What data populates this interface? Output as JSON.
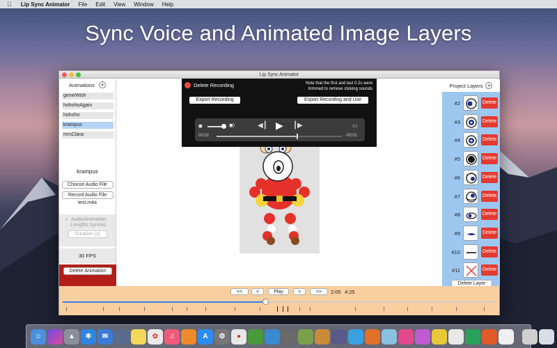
{
  "menubar": {
    "app_name": "Lip Sync Animator",
    "menus": [
      "File",
      "Edit",
      "View",
      "Window",
      "Help"
    ]
  },
  "headline": "Sync Voice and Animated Image Layers",
  "window": {
    "title": "Lip Sync Animator"
  },
  "animations_panel": {
    "header": "Animations",
    "items": [
      "genieWish",
      "hohohoAgain",
      "hohoho",
      "krampus",
      "mrsClaus"
    ],
    "selected_index": 3,
    "selected_name": "krampus",
    "choose_audio_label": "Choose Audio File",
    "record_audio_label": "Record Audio File",
    "audio_filename": "test.m4a",
    "sync_checkbox_label_1": "Audio/Animation",
    "sync_checkbox_label_2": "Lengths Synced",
    "duration_placeholder": "Duration (s)",
    "fps_label": "30 FPS",
    "delete_animation_label": "Delete Animation"
  },
  "recording": {
    "delete_label": "Delete Recording",
    "note": "Note that the first and last 0.2s were trimmed to remove clicking sounds",
    "export_label": "Export Recording",
    "export_use_label": "Export Recording and Use",
    "elapsed": "00:02",
    "remaining": "-00:01",
    "playback_fraction": 0.64,
    "volume_fraction": 0.9
  },
  "layers_panel": {
    "header": "Project Layers",
    "layers": [
      {
        "num": "#2",
        "icon": "eye-icon-left"
      },
      {
        "num": "#3",
        "icon": "eye-icon-center"
      },
      {
        "num": "#4",
        "icon": "eye-icon-center"
      },
      {
        "num": "#5",
        "icon": "eye-icon-center-large"
      },
      {
        "num": "#6",
        "icon": "eye-icon-right"
      },
      {
        "num": "#7",
        "icon": "eye-icon-up"
      },
      {
        "num": "#8",
        "icon": "eye-icon-side"
      },
      {
        "num": "#9",
        "icon": "eye-icon-closed"
      },
      {
        "num": "#10",
        "icon": "line-icon"
      },
      {
        "num": "#11",
        "icon": "x-icon"
      }
    ],
    "delete_label": "Delete",
    "delete_layer_label": "Delete Layer"
  },
  "timeline": {
    "rewind_label": "<<",
    "back_label": "<",
    "play_label": "Play",
    "forward_label": ">",
    "ffwd_label": ">>",
    "current_time": "2:05",
    "total_time": "4:25",
    "progress_fraction": 0.47
  },
  "colors": {
    "accent": "#3b7ff0",
    "delete_red": "#e23b2f",
    "delete_anim_bg": "#b41e1a",
    "layers_bg": "#9ec7f0",
    "timeline_bg": "#f9cfa0",
    "selection": "#b6d4f5"
  }
}
